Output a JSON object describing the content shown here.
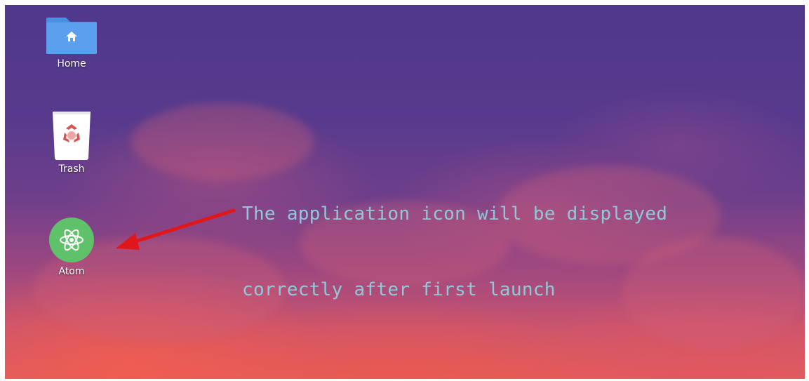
{
  "desktop": {
    "icons": [
      {
        "label": "Home",
        "icon": "home-folder-icon",
        "color": "#4a90e2"
      },
      {
        "label": "Trash",
        "icon": "trash-icon",
        "color": "#ffffff"
      },
      {
        "label": "Atom",
        "icon": "atom-icon",
        "color": "#5fc26a"
      }
    ],
    "annotation": {
      "line1": "The application icon will be displayed",
      "line2": "correctly after first launch",
      "color": "#8fc9d8"
    },
    "arrow": {
      "color": "#e0161b"
    }
  }
}
